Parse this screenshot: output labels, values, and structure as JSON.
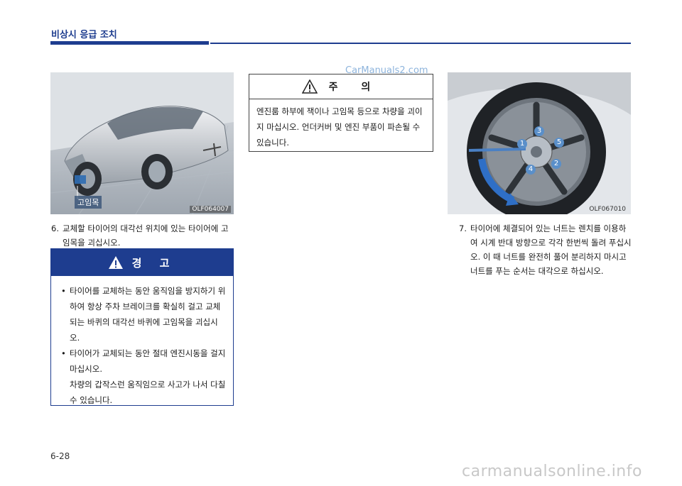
{
  "header": {
    "section_title": "비상시 응급 조치"
  },
  "figure_left": {
    "code": "OLF064007",
    "label": "고임목"
  },
  "step6": {
    "number": "6.",
    "text": "교체할 타이어의 대각선 위치에 있는 타이어에 고임목을 괴십시오."
  },
  "warning": {
    "title": "경 고",
    "items": [
      {
        "bullet": "•",
        "text": "타이어를 교체하는 동안 움직임을 방지하기 위하여 항상 주차 브레이크를 확실히 걸고 교체되는 바퀴의 대각선 바퀴에 고임목을 괴십시오."
      },
      {
        "bullet": "•",
        "text": "타이어가 교체되는 동안 절대 엔진시동을 걸지 마십시오.",
        "continuation": "차량의 갑작스런 움직임으로 사고가 나서 다칠 수 있습니다."
      }
    ]
  },
  "caution": {
    "title": "주 의",
    "text": "엔진룸 하부에 잭이나 고임목 등으로 차량을 괴이지 마십시오. 언더커버 및 엔진 부품이 파손될 수 있습니다."
  },
  "figure_right": {
    "code": "OLF067010",
    "nut_numbers": [
      "1",
      "2",
      "3",
      "4",
      "5"
    ]
  },
  "step7": {
    "number": "7.",
    "text": "타이어에 체결되어 있는 너트는 렌치를 이용하여 시계 반대 방향으로 각각 한번씩 돌려 푸십시오. 이 때 너트를 완전히 풀어 분리하지 마시고 너트를 푸는 순서는 대각으로 하십시오."
  },
  "page_number": "6-28",
  "watermarks": {
    "top": "CarManuals2.com",
    "bottom": "carmanualsonline.info"
  }
}
